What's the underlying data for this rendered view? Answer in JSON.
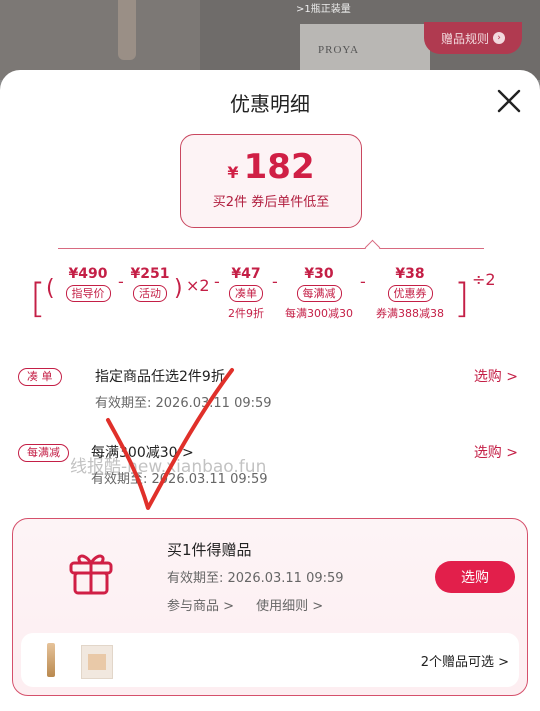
{
  "background": {
    "box_brand": "PROYA",
    "note": ">1瓶正装量",
    "gift_rules": "赠品规则",
    "gift_rules_icon": "chevron-right-circle-icon"
  },
  "sheet": {
    "title": "优惠明细",
    "close_icon": "close-icon"
  },
  "price": {
    "currency": "¥",
    "amount": "182",
    "subtitle": "买2件 券后单件低至"
  },
  "formula": {
    "guide_price": "¥490",
    "guide_label": "指导价",
    "activity_price": "¥251",
    "activity_label": "活动",
    "times": "×2",
    "minus": "-",
    "bundle_amount": "¥47",
    "bundle_label": "凑单",
    "bundle_note": "2件9折",
    "full_amount": "¥30",
    "full_label": "每满减",
    "full_note": "每满300减30",
    "coupon_amount": "¥38",
    "coupon_label": "优惠券",
    "coupon_note": "券满388减38",
    "divide": "÷2",
    "lbracket": "[",
    "rbracket": "]",
    "lparen": "(",
    "rparen": ")"
  },
  "promos": [
    {
      "tag": "凑 单",
      "title": "指定商品任选2件9折",
      "valid": "有效期至: 2026.03.11 09:59",
      "action": "选购 >"
    },
    {
      "tag": "每满减",
      "title": "每满300减30 >",
      "valid": "有效期至: 2026.03.11 09:59",
      "action": "选购 >"
    }
  ],
  "gift": {
    "title": "买1件得赠品",
    "valid": "有效期至: 2026.03.11 09:59",
    "link1": "参与商品 >",
    "link2": "使用细则 >",
    "button": "选购",
    "count": "2个赠品可选 >",
    "icon": "gift-icon"
  },
  "watermark": "线报酷-new.xianbao.fun",
  "colors": {
    "accent": "#c41f46",
    "button": "#e21f4b"
  }
}
